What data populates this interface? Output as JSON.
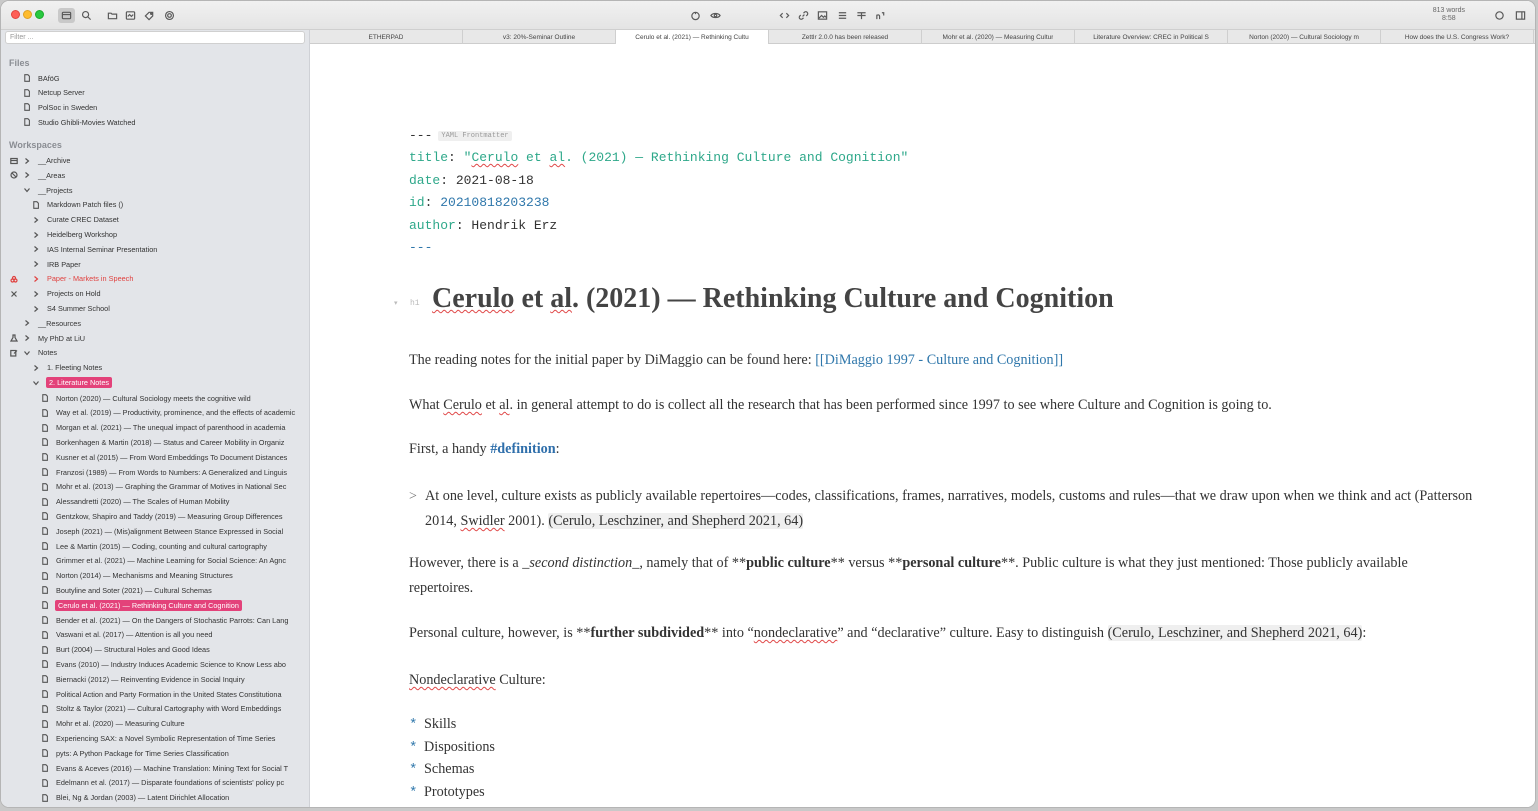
{
  "titlebar": {
    "word_count": "813 words",
    "time": "8:58"
  },
  "sidebar": {
    "filter_placeholder": "Filter ...",
    "files_title": "Files",
    "files": [
      "BAföG",
      "Netcup Server",
      "PolSoc in Sweden",
      "Studio Ghibli-Movies Watched"
    ],
    "workspaces_title": "Workspaces",
    "tree": [
      {
        "label": "__Archive"
      },
      {
        "label": "__Areas"
      },
      {
        "label": "__Projects"
      },
      {
        "label": "Markdown Patch files ()"
      },
      {
        "label": "Curate CREC Dataset"
      },
      {
        "label": "Heidelberg Workshop"
      },
      {
        "label": "IAS Internal Seminar Presentation"
      },
      {
        "label": "IRB Paper"
      },
      {
        "label": "Paper - Markets in Speech"
      },
      {
        "label": "Projects on Hold"
      },
      {
        "label": "S4 Summer School"
      },
      {
        "label": "__Resources"
      },
      {
        "label": "My PhD at LiU"
      },
      {
        "label": "Notes"
      },
      {
        "label": "1. Fleeting Notes"
      },
      {
        "label": "2. Literature Notes"
      }
    ],
    "notes": [
      "Norton (2020) — Cultural Sociology meets the cognitive wild",
      "Way et al. (2019) — Productivity, prominence, and the effects of academic",
      "Morgan et al. (2021) — The unequal impact of parenthood in academia",
      "Borkenhagen & Martin (2018) — Status and Career Mobility in Organiz",
      "Kusner et al (2015) — From Word Embeddings To Document Distances",
      "Franzosi (1989) — From Words to Numbers: A Generalized and Linguis",
      "Mohr et al. (2013) — Graphing the Grammar of Motives in National Sec",
      "Alessandretti (2020) — The Scales of Human Mobility",
      "Gentzkow, Shapiro and Taddy (2019) — Measuring Group Differences",
      "Joseph (2021) — (Mis)alignment Between Stance Expressed in Social",
      "Lee & Martin (2015) — Coding, counting and cultural cartography",
      "Grimmer et al. (2021) — Machine Learning for Social Science: An Agnc",
      "Norton (2014) — Mechanisms and Meaning Structures",
      "Boutyline and Soter (2021) — Cultural Schemas",
      "Cerulo et al. (2021) — Rethinking Culture and Cognition",
      "Bender et al. (2021) — On the Dangers of Stochastic Parrots: Can Lang",
      "Vaswani et al. (2017) — Attention is all you need",
      "Burt (2004) — Structural Holes and Good Ideas",
      "Evans (2010) — Industry Induces Academic Science to Know Less abo",
      "Biernacki (2012) — Reinventing Evidence in Social Inquiry",
      "Political Action and Party Formation in the United States Constitutiona",
      "Stoltz & Taylor (2021) — Cultural Cartography with Word Embeddings",
      "Mohr et al. (2020) — Measuring Culture",
      "Experiencing SAX: a Novel Symbolic Representation of Time Series",
      "pyts: A Python Package for Time Series Classification",
      "Evans & Aceves (2016) — Machine Translation: Mining Text for Social T",
      "Edelmann et al. (2017) — Disparate foundations of scientists' policy pc",
      "Blei, Ng & Jordan (2003) — Latent Dirichlet Allocation"
    ]
  },
  "tabs": [
    "ETHERPAD",
    "v3: 20%-Seminar Outline",
    "Cerulo et al. (2021) — Rethinking Cultu",
    "Zettlr 2.0.0 has been released",
    "Mohr et al. (2020) — Measuring Cultur",
    "Literature Overview: CREC in Political S",
    "Norton (2020) — Cultural Sociology m",
    "How does the U.S. Congress Work?"
  ],
  "editor": {
    "yaml_dashes": "---",
    "yaml_badge": "YAML Frontmatter",
    "title_key": "title",
    "title_open": "\"",
    "title_w1": "Cerulo",
    "title_w2": " et ",
    "title_w3": "al",
    "title_rest": ". (2021) — Rethinking Culture and Cognition\"",
    "date_key": "date",
    "date_val": "2021-08-18",
    "id_key": "id",
    "id_val": "20210818203238",
    "author_key": "author",
    "author_val": "Hendrik Erz",
    "yaml_end": "---",
    "h1_mark": "h1",
    "h1_w1": "Cerulo",
    "h1_w2": " et ",
    "h1_w3": "al",
    "h1_rest": ". (2021) — Rethinking Culture and Cognition",
    "p1_text": "The reading notes for the initial paper by DiMaggio can be found here: ",
    "p1_link": "[[DiMaggio 1997 - Culture and Cognition]]",
    "p2_a": "What ",
    "p2_b": "Cerulo",
    "p2_c": " et ",
    "p2_d": "al",
    "p2_e": ". in general attempt to do is collect all the research that has been performed since 1997 to see where Culture and Cognition is going to.",
    "p3_a": "First, a handy ",
    "p3_tag": "#definition",
    "p3_b": ":",
    "quote_mark": ">",
    "quote_a": "At one level, culture exists as publicly available repertoires—codes, classifications, frames, narratives, models, customs and rules—that we draw upon when we think and act (Patterson 2014, ",
    "quote_b": "Swidler",
    "quote_c": " 2001). ",
    "quote_cite": "(Cerulo, Leschziner, and Shepherd 2021, 64)",
    "p4_a": "However, there is a ",
    "p4_em": "_second distinction_",
    "p4_b": ", namely that of **",
    "p4_bold1": "public culture",
    "p4_c": "** versus **",
    "p4_bold2": "personal culture",
    "p4_d": "**. Public culture is what they just mentioned: Those publicly available repertoires.",
    "p5_a": "Personal culture, however, is **",
    "p5_bold": "further subdivided",
    "p5_b": "** into “",
    "p5_c": "nondeclarative",
    "p5_d": "” and “declarative” culture. Easy to distinguish ",
    "p5_cite": "(Cerulo, Leschziner, and Shepherd 2021, 64)",
    "p5_e": ":",
    "p6_a": "Nondeclarative",
    "p6_b": " Culture:",
    "bullet_marker": "*",
    "bullets": [
      "Skills",
      "Dispositions",
      "Schemas",
      "Prototypes"
    ]
  }
}
